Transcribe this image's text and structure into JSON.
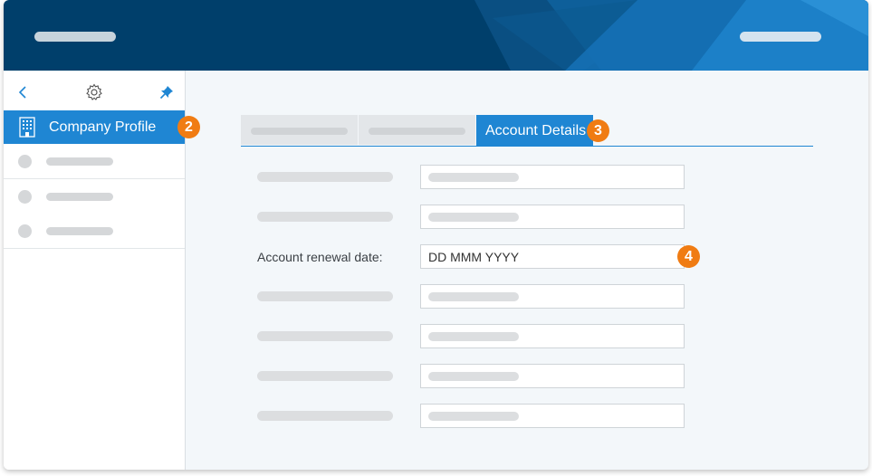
{
  "sidebar": {
    "active_item": {
      "label": "Company Profile",
      "icon": "building-icon",
      "badge": "2"
    },
    "toolbar_icons": [
      "chevron-left-icon",
      "gear-icon",
      "pin-icon"
    ]
  },
  "tabs": {
    "active_label": "Account Details",
    "active_badge": "3"
  },
  "form": {
    "renewal_label": "Account renewal date:",
    "renewal_value": "DD MMM YYYY",
    "renewal_badge": "4"
  },
  "colors": {
    "header": "#003f6b",
    "accent": "#1f86d3",
    "badge": "#f07c13"
  }
}
